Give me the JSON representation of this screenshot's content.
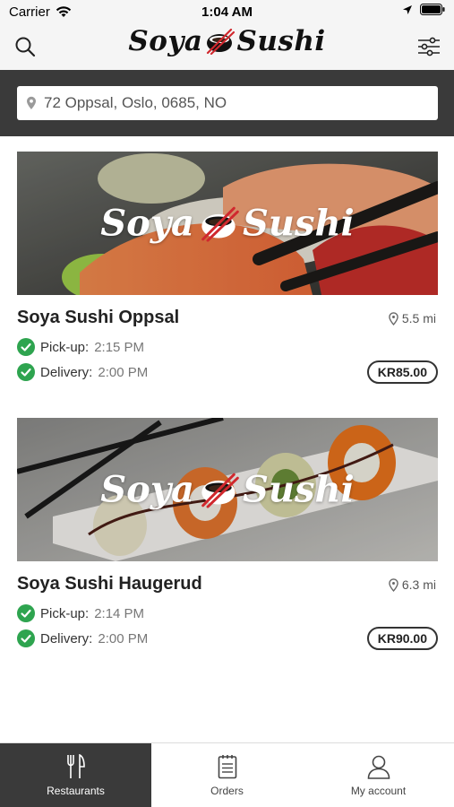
{
  "status_bar": {
    "carrier": "Carrier",
    "time": "1:04 AM"
  },
  "header": {
    "logo_left": "Soya",
    "logo_right": "Sushi"
  },
  "address": {
    "value": "72 Oppsal, Oslo, 0685, NO"
  },
  "restaurants": [
    {
      "name": "Soya Sushi Oppsal",
      "distance": "5.5 mi",
      "pickup_label": "Pick-up:",
      "pickup_time": "2:15 PM",
      "delivery_label": "Delivery:",
      "delivery_time": "2:00 PM",
      "min_price": "KR85.00",
      "brand_left": "Soya",
      "brand_right": "Sushi"
    },
    {
      "name": "Soya Sushi Haugerud",
      "distance": "6.3 mi",
      "pickup_label": "Pick-up:",
      "pickup_time": "2:14 PM",
      "delivery_label": "Delivery:",
      "delivery_time": "2:00 PM",
      "min_price": "KR90.00",
      "brand_left": "Soya",
      "brand_right": "Sushi"
    }
  ],
  "tabs": [
    {
      "label": "Restaurants",
      "icon": "fork-knife-icon",
      "active": true
    },
    {
      "label": "Orders",
      "icon": "clipboard-icon",
      "active": false
    },
    {
      "label": "My account",
      "icon": "person-icon",
      "active": false
    }
  ],
  "colors": {
    "dark": "#3a3a3a",
    "accent_red": "#d0282e",
    "check_green": "#2ea44f"
  }
}
